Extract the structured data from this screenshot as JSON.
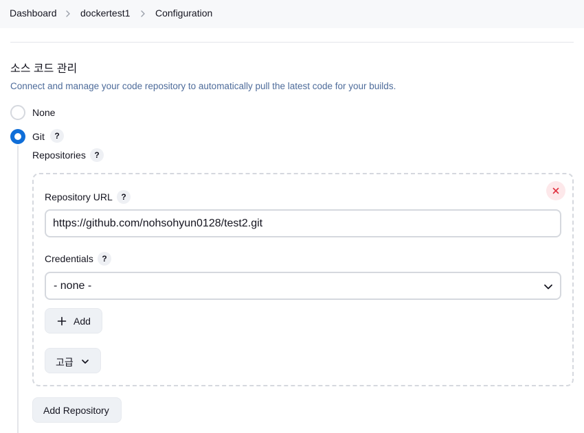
{
  "breadcrumb": {
    "items": [
      "Dashboard",
      "dockertest1",
      "Configuration"
    ]
  },
  "section": {
    "title": "소스 코드 관리",
    "description": "Connect and manage your code repository to automatically pull the latest code for your builds."
  },
  "scm_options": {
    "none_label": "None",
    "git_label": "Git",
    "selected": "Git"
  },
  "repositories": {
    "label": "Repositories",
    "url_label": "Repository URL",
    "url_value": "https://github.com/nohsohyun0128/test2.git",
    "credentials_label": "Credentials",
    "credentials_value": "- none -",
    "add_label": "Add",
    "advanced_label": "고급",
    "add_repository_label": "Add Repository"
  },
  "help_glyph": "?",
  "colors": {
    "accent": "#0f6ed8",
    "description": "#4d6b9a",
    "close_bg": "#fde8ea",
    "close_icon": "#e0303f"
  },
  "icons": [
    "chevron-right-icon",
    "help-icon",
    "close-icon",
    "chevron-down-icon",
    "plus-icon"
  ]
}
